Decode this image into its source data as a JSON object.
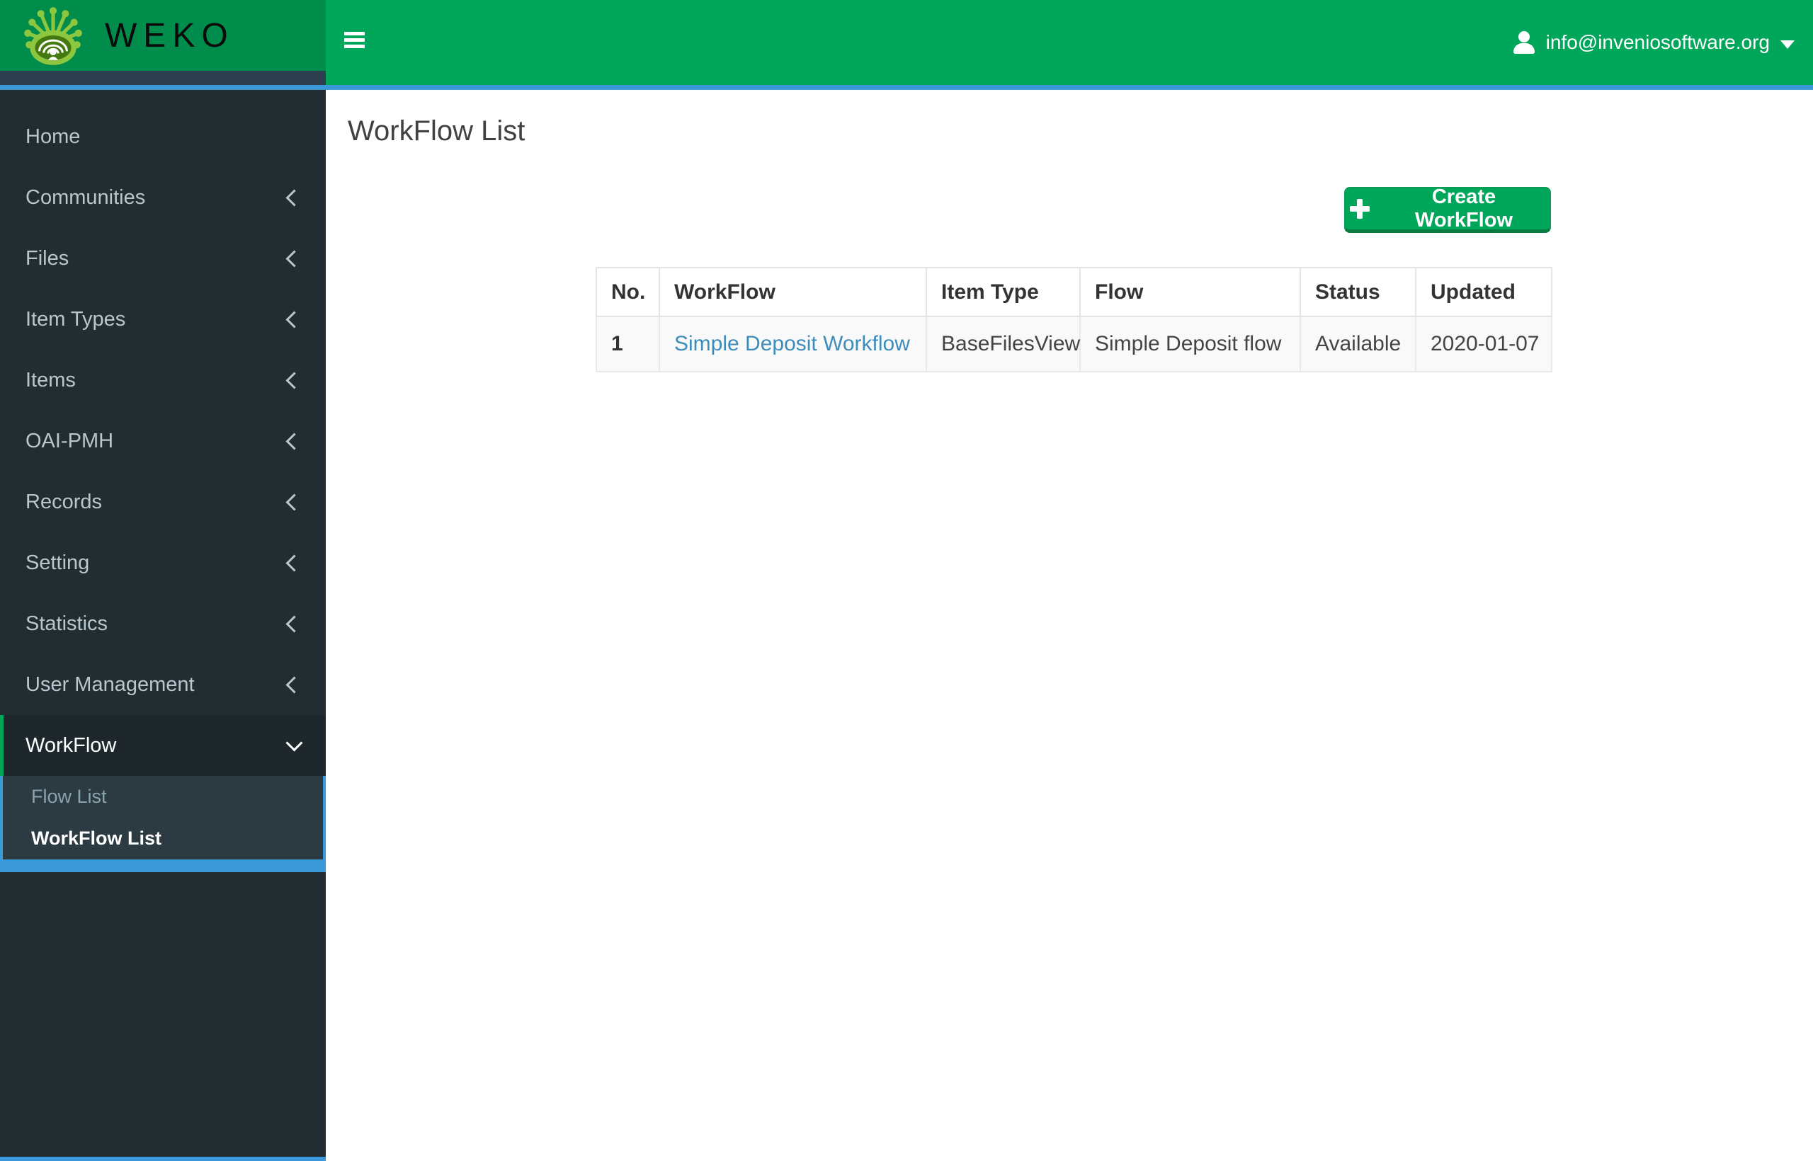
{
  "app": {
    "brand": "WEKO"
  },
  "header": {
    "user_email": "info@inveniosoftware.org",
    "icons": {
      "menu": "hamburger-icon",
      "user": "person-icon",
      "dropdown": "caret-down-icon",
      "brand": "weko-logo-icon"
    }
  },
  "sidebar": {
    "items": [
      {
        "label": "Home",
        "has_chevron": false,
        "active": false
      },
      {
        "label": "Communities",
        "has_chevron": true,
        "active": false
      },
      {
        "label": "Files",
        "has_chevron": true,
        "active": false
      },
      {
        "label": "Item Types",
        "has_chevron": true,
        "active": false
      },
      {
        "label": "Items",
        "has_chevron": true,
        "active": false
      },
      {
        "label": "OAI-PMH",
        "has_chevron": true,
        "active": false
      },
      {
        "label": "Records",
        "has_chevron": true,
        "active": false
      },
      {
        "label": "Setting",
        "has_chevron": true,
        "active": false
      },
      {
        "label": "Statistics",
        "has_chevron": true,
        "active": false
      },
      {
        "label": "User Management",
        "has_chevron": true,
        "active": false
      },
      {
        "label": "WorkFlow",
        "has_chevron": true,
        "active": true,
        "expanded": true
      }
    ],
    "submenu": {
      "parent": "WorkFlow",
      "items": [
        {
          "label": "Flow List",
          "active": false
        },
        {
          "label": "WorkFlow List",
          "active": true
        }
      ]
    }
  },
  "main": {
    "page_title": "WorkFlow List",
    "create_button": {
      "label": "Create WorkFlow",
      "icon": "plus-icon"
    },
    "table": {
      "columns": [
        "No.",
        "WorkFlow",
        "Item Type",
        "Flow",
        "Status",
        "Updated"
      ],
      "rows": [
        {
          "no": "1",
          "workflow": "Simple Deposit Workflow",
          "item_type": "BaseFilesView",
          "flow": "Simple Deposit flow",
          "status": "Available",
          "updated": "2020-01-07"
        }
      ]
    }
  },
  "colors": {
    "navbar_green": "#00a65a",
    "logo_block_green": "#008d4c",
    "logo_lime": "#8dc63f",
    "accent_blue": "#3c99d9",
    "logo_strip": "#2c3e50",
    "sidebar_bg": "#222d32",
    "sidebar_active_bg": "#1e282c",
    "submenu_bg": "#2c3b41",
    "sidebar_text": "#b8c7ce",
    "submenu_muted_text": "#8aa4af",
    "link_blue": "#3c8dbc",
    "table_row_stripe": "#f9f9f9"
  }
}
